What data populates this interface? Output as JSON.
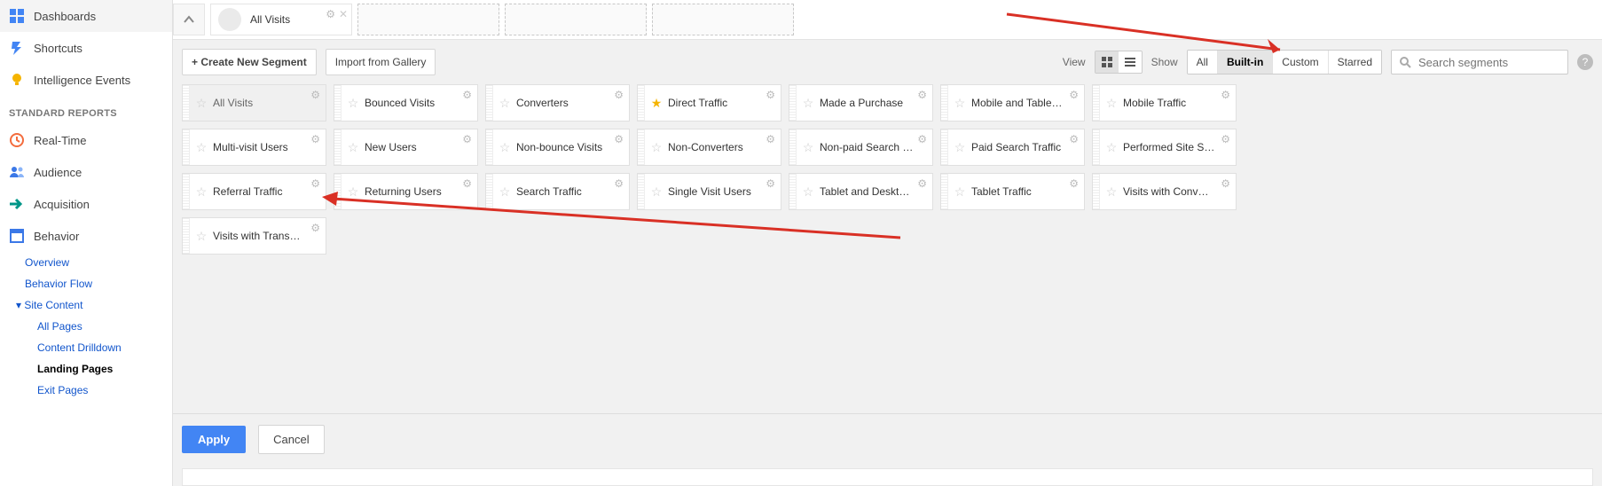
{
  "sidebar": {
    "items": [
      {
        "label": "Dashboards",
        "icon": "dashboards-icon",
        "color": "#4285f4"
      },
      {
        "label": "Shortcuts",
        "icon": "shortcuts-icon",
        "color": "#4285f4"
      },
      {
        "label": "Intelligence Events",
        "icon": "intelligence-icon",
        "color": "#f5b400"
      }
    ],
    "reports_header": "STANDARD REPORTS",
    "reports": [
      {
        "label": "Real-Time",
        "icon": "realtime-icon",
        "color": "#f36c3d"
      },
      {
        "label": "Audience",
        "icon": "audience-icon",
        "color": "#3b78e7"
      },
      {
        "label": "Acquisition",
        "icon": "acquisition-icon",
        "color": "#009688"
      },
      {
        "label": "Behavior",
        "icon": "behavior-icon",
        "color": "#3b78e7"
      }
    ],
    "behavior_children": [
      {
        "label": "Overview",
        "level": 1
      },
      {
        "label": "Behavior Flow",
        "level": 1
      },
      {
        "label": "Site Content",
        "level": 1,
        "caret": true
      },
      {
        "label": "All Pages",
        "level": 2
      },
      {
        "label": "Content Drilldown",
        "level": 2
      },
      {
        "label": "Landing Pages",
        "level": 2,
        "active": true
      },
      {
        "label": "Exit Pages",
        "level": 2
      }
    ]
  },
  "top": {
    "current_segment": "All Visits"
  },
  "controls": {
    "create": "+ Create New Segment",
    "import": "Import from Gallery",
    "view_label": "View",
    "show_label": "Show",
    "filters": [
      "All",
      "Built-in",
      "Custom",
      "Starred"
    ],
    "filter_active": "Built-in",
    "search_placeholder": "Search segments"
  },
  "segments": [
    {
      "name": "All Visits",
      "selected": true,
      "starred": false
    },
    {
      "name": "Bounced Visits",
      "starred": false
    },
    {
      "name": "Converters",
      "starred": false
    },
    {
      "name": "Direct Traffic",
      "starred": true
    },
    {
      "name": "Made a Purchase",
      "starred": false
    },
    {
      "name": "Mobile and Table…",
      "starred": false
    },
    {
      "name": "Mobile Traffic",
      "starred": false
    },
    {
      "name": "Multi-visit Users",
      "starred": false
    },
    {
      "name": "New Users",
      "starred": false
    },
    {
      "name": "Non-bounce Visits",
      "starred": false
    },
    {
      "name": "Non-Converters",
      "starred": false
    },
    {
      "name": "Non-paid Search …",
      "starred": false
    },
    {
      "name": "Paid Search Traffic",
      "starred": false
    },
    {
      "name": "Performed Site S…",
      "starred": false
    },
    {
      "name": "Referral Traffic",
      "starred": false
    },
    {
      "name": "Returning Users",
      "starred": false
    },
    {
      "name": "Search Traffic",
      "starred": false
    },
    {
      "name": "Single Visit Users",
      "starred": false
    },
    {
      "name": "Tablet and Deskt…",
      "starred": false
    },
    {
      "name": "Tablet Traffic",
      "starred": false
    },
    {
      "name": "Visits with Conv…",
      "starred": false
    },
    {
      "name": "Visits with Trans…",
      "starred": false
    }
  ],
  "footer": {
    "apply": "Apply",
    "cancel": "Cancel"
  }
}
